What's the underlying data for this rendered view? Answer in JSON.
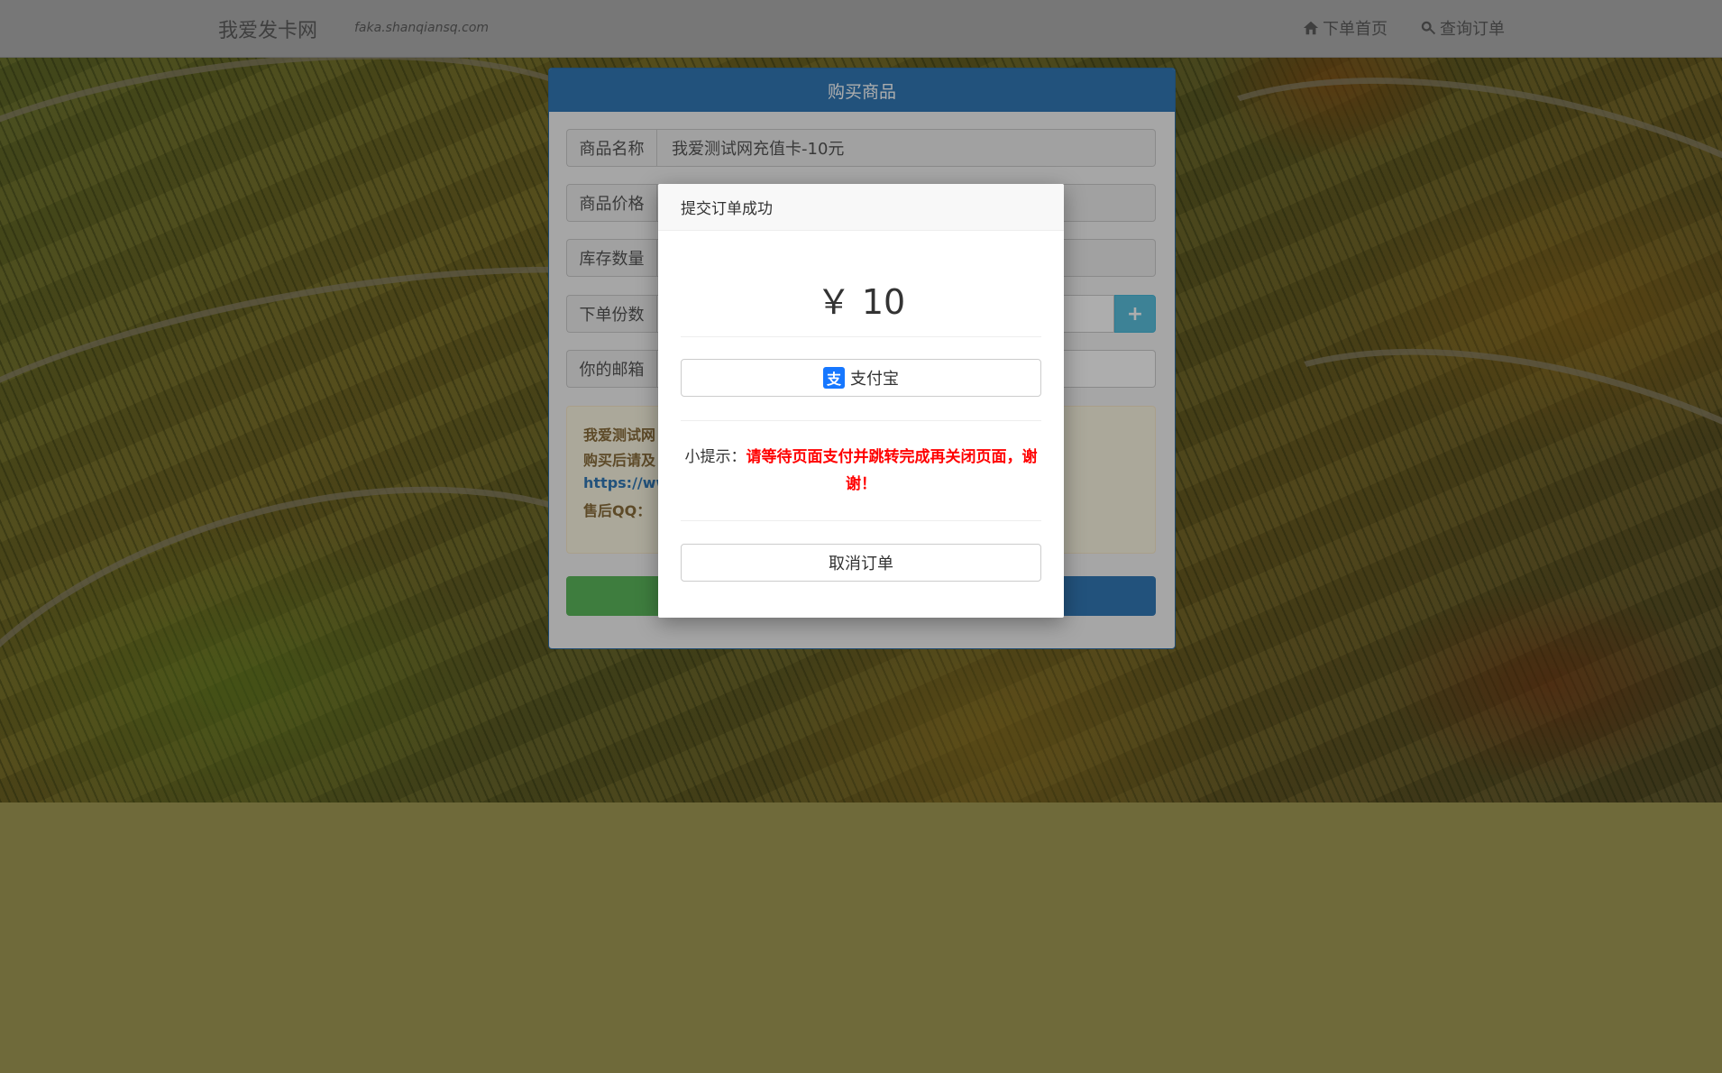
{
  "navbar": {
    "brand": "我爱发卡网",
    "domain": "faka.shanqiansq.com",
    "home_label": "下单首页",
    "query_label": "查询订单"
  },
  "panel": {
    "title": "购买商品",
    "rows": [
      {
        "label": "商品名称",
        "value": "我爱测试网充值卡-10元"
      },
      {
        "label": "商品价格",
        "value": ""
      },
      {
        "label": "库存数量",
        "value": ""
      },
      {
        "label": "下单份数",
        "value": ""
      },
      {
        "label": "你的邮箱",
        "value": ""
      }
    ],
    "plus_label": "+",
    "info_line1": "我爱测试网",
    "info_line2": "购买后请及",
    "info_link": "https://ww",
    "info_qq": "售后QQ："
  },
  "modal": {
    "title": "提交订单成功",
    "amount": "￥ 10",
    "pay_method": "支付宝",
    "tip_prefix": "小提示：",
    "tip_warning": "请等待页面支付并跳转完成再关闭页面，谢谢！",
    "cancel_label": "取消订单"
  },
  "icons": {
    "home": "home-icon",
    "search": "search-icon",
    "alipay": "alipay-icon"
  },
  "colors": {
    "primary": "#337ab7",
    "success": "#5cb85c",
    "info": "#5bc0de",
    "warning_text": "#ff0000",
    "alipay": "#1677ff"
  }
}
